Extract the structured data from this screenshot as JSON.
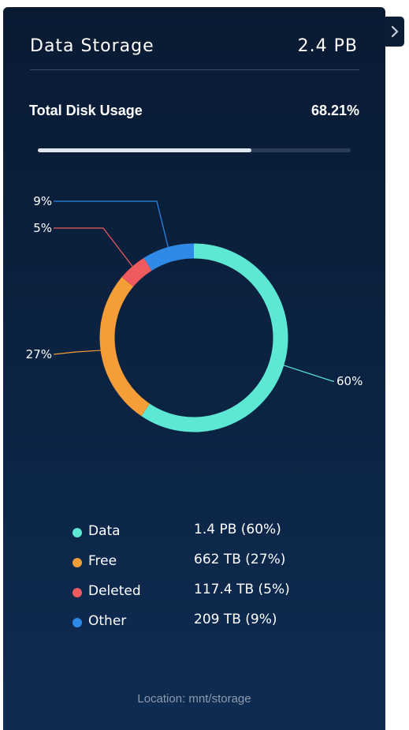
{
  "header": {
    "title": "Data Storage",
    "total": "2.4 PB"
  },
  "usage": {
    "label": "Total Disk Usage",
    "percent_text": "68.21%",
    "progress": 0.6821
  },
  "colors": {
    "data": "#5ce8d2",
    "free": "#f59d36",
    "deleted": "#ef5a5e",
    "other": "#2e8ae6"
  },
  "chart_data": {
    "type": "pie",
    "series": [
      {
        "name": "Data",
        "value": 60,
        "label": "60%"
      },
      {
        "name": "Free",
        "value": 27,
        "label": "27%"
      },
      {
        "name": "Deleted",
        "value": 5,
        "label": "5%"
      },
      {
        "name": "Other",
        "value": 9,
        "label": "9%"
      }
    ]
  },
  "legend": [
    {
      "name": "Data",
      "value": "1.4 PB (60%)",
      "color": "#5ce8d2"
    },
    {
      "name": "Free",
      "value": "662 TB (27%)",
      "color": "#f59d36"
    },
    {
      "name": "Deleted",
      "value": "117.4 TB (5%)",
      "color": "#ef5a5e"
    },
    {
      "name": "Other",
      "value": "209 TB (9%)",
      "color": "#2e8ae6"
    }
  ],
  "footer": {
    "location": "Location: mnt/storage"
  },
  "icons": {
    "toggle": "chevron-right-icon"
  }
}
